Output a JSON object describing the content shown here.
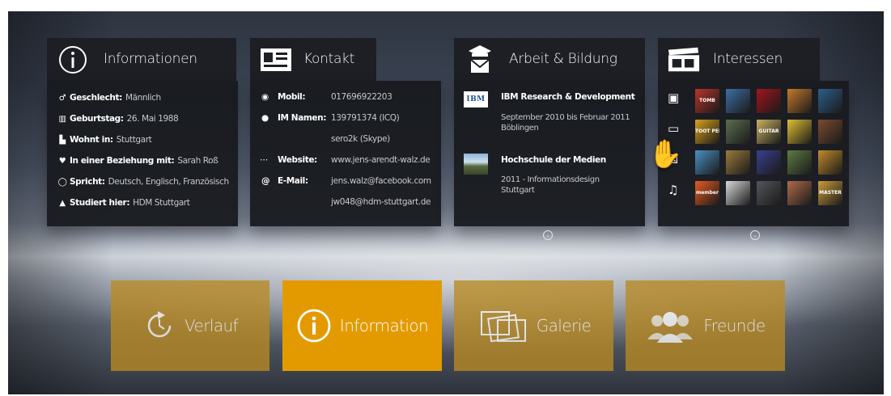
{
  "cards": {
    "info": {
      "title": "Informationen",
      "icon": "info-icon",
      "rows": [
        {
          "icon": "gender-icon",
          "key": "Geschlecht:",
          "value": "Männlich"
        },
        {
          "icon": "birthday-cake-icon",
          "key": "Geburtstag:",
          "value": "26. Mai 1988"
        },
        {
          "icon": "city-icon",
          "key": "Wohnt in:",
          "value": "Stuttgart"
        },
        {
          "icon": "heart-icon",
          "key": "In einer Beziehung mit:",
          "value": "Sarah Roß"
        },
        {
          "icon": "speech-icon",
          "key": "Spricht:",
          "value": "Deutsch, Englisch, Französisch"
        },
        {
          "icon": "graduation-cap-icon",
          "key": "Studiert hier:",
          "value": "HDM Stuttgart"
        }
      ]
    },
    "contact": {
      "title": "Kontakt",
      "icon": "contact-card-icon",
      "mobile": {
        "icon": "phone-icon",
        "label": "Mobil:",
        "value": "017696922203"
      },
      "im": {
        "icon": "chat-bubble-icon",
        "label": "IM Namen:",
        "values": [
          "139791374 (ICQ)",
          "sero2k (Skype)"
        ]
      },
      "website": {
        "icon": "link-icon",
        "label": "Website:",
        "value": "www.jens-arendt-walz.de"
      },
      "email": {
        "icon": "at-sign-icon",
        "label": "E-Mail:",
        "values": [
          "jens.walz@facebook.com",
          "jw048@hdm-stuttgart.de"
        ]
      }
    },
    "work": {
      "title": "Arbeit & Bildung",
      "icon": "school-mail-icon",
      "entries": [
        {
          "logo": "IBM",
          "name": "IBM Research & Development",
          "detail": "September 2010 bis Februar 2011",
          "place": "Böblingen"
        },
        {
          "logo": "building-photo",
          "name": "Hochschule der Medien",
          "detail": "2011 - Informationsdesign",
          "place": "Stuttgart"
        }
      ]
    },
    "interests": {
      "title": "Interessen",
      "icon": "film-clapper-icon",
      "categories": [
        "movie-camera-icon",
        "tv-icon",
        "dice-icon",
        "music-note-icon"
      ],
      "thumbnail_colors": [
        [
          "#b8342a",
          "#3d6fa3",
          "#a2151c",
          "#c47a2a",
          "#2d5e8c"
        ],
        [
          "#d6a21c",
          "#5b6e4e",
          "#c9b163",
          "#e0c032",
          "#7a4b2f"
        ],
        [
          "#4a90c2",
          "#9a7b3c",
          "#3b3f8f",
          "#5e7a43",
          "#c08b2a"
        ],
        [
          "#e25b22",
          "#d8d8d8",
          "#55565c",
          "#b06b4a",
          "#cc9a3b"
        ]
      ],
      "thumbnail_labels": [
        "TOMB",
        "",
        "",
        "",
        "",
        "TOOT PERS",
        "",
        "GUITAR",
        "",
        "",
        "",
        "",
        "",
        "",
        "",
        "member",
        "",
        "",
        "",
        "MASTER"
      ]
    }
  },
  "tiles": [
    {
      "label": "Verlauf",
      "icon": "history-icon",
      "color": "#b98a22",
      "active": false
    },
    {
      "label": "Information",
      "icon": "info-circle-icon",
      "color": "#e39a00",
      "active": true
    },
    {
      "label": "Galerie",
      "icon": "gallery-icon",
      "color": "#b98a22",
      "active": false
    },
    {
      "label": "Freunde",
      "icon": "friends-icon",
      "color": "#b98a22",
      "active": false
    }
  ],
  "colors": {
    "card_bg": "#1d1f24",
    "tile_active": "#e39a00",
    "tile_inactive": "#b98a22"
  }
}
